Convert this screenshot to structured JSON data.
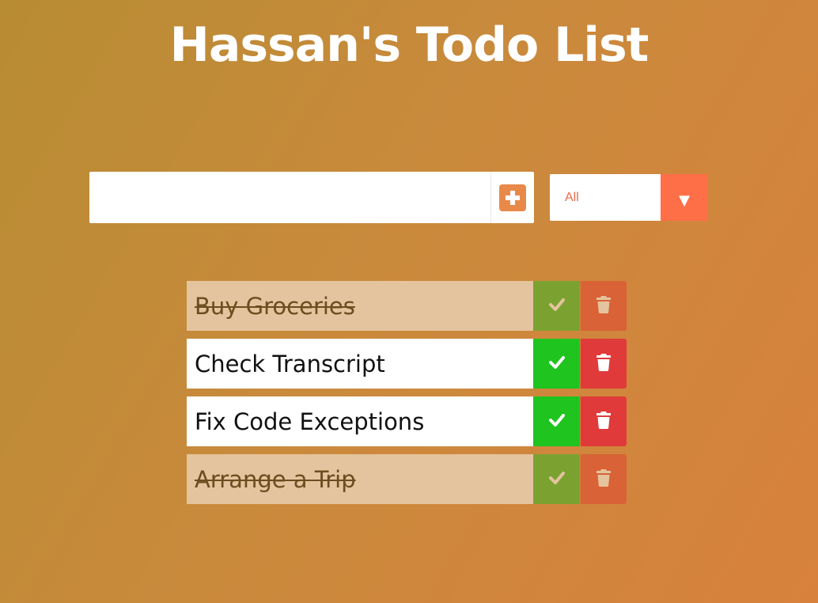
{
  "app": {
    "title": "Hassan's Todo List"
  },
  "form": {
    "input_value": "",
    "input_placeholder": "",
    "add_icon": "plus-square-icon"
  },
  "filter": {
    "selected": "All",
    "icon": "caret-down-icon"
  },
  "todos": [
    {
      "text": "Buy Groceries",
      "completed": true
    },
    {
      "text": "Check Transcript",
      "completed": false
    },
    {
      "text": "Fix Code Exceptions",
      "completed": false
    },
    {
      "text": "Arrange a Trip",
      "completed": true
    }
  ],
  "colors": {
    "accent_orange": "#ff6f47",
    "check_green": "#1fc41f",
    "trash_red": "#e03a3a",
    "completed_bg": "#e4c49e"
  }
}
